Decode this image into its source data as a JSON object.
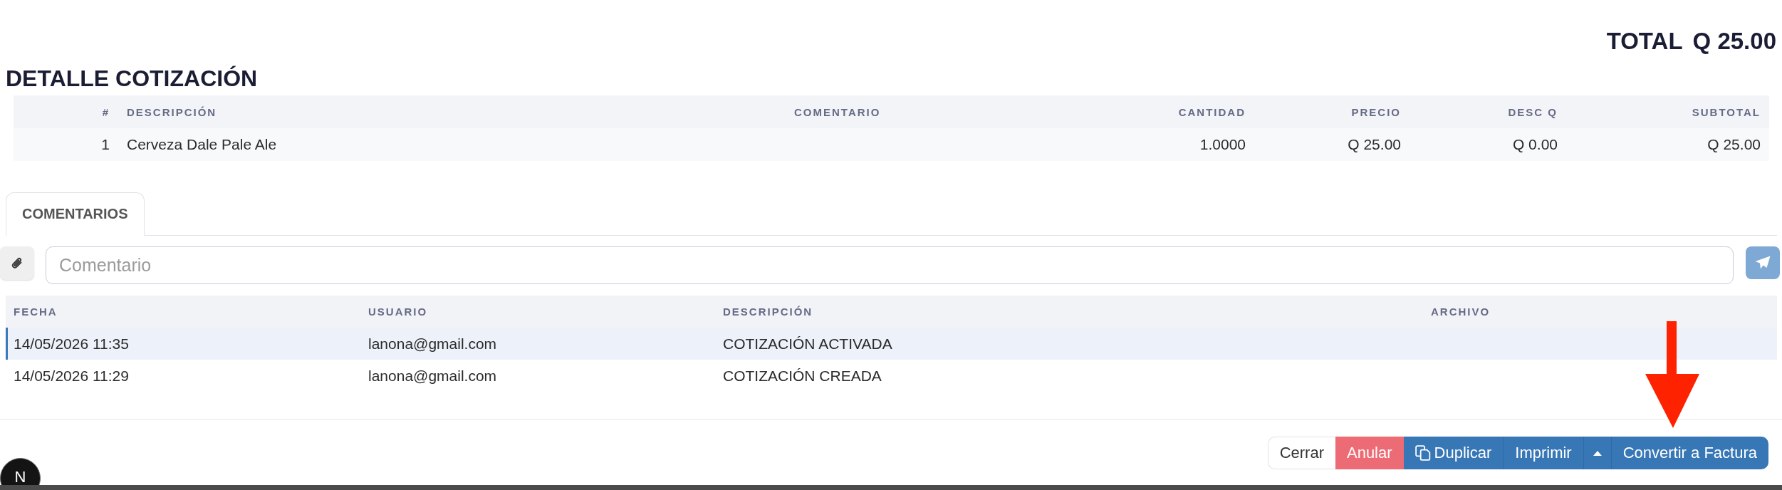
{
  "summary": {
    "total_label": "TOTAL",
    "total_value": "Q 25.00"
  },
  "detail": {
    "title": "DETALLE COTIZACIÓN",
    "columns": [
      "#",
      "DESCRIPCIÓN",
      "COMENTARIO",
      "CANTIDAD",
      "PRECIO",
      "DESC Q",
      "SUBTOTAL"
    ],
    "rows": [
      {
        "number": "1",
        "description": "Cerveza Dale Pale Ale",
        "quantity": "1.0000",
        "price": "Q 25.00",
        "discount": "Q 0.00",
        "subtotal": "Q 25.00"
      }
    ]
  },
  "comments": {
    "tabs": [
      {
        "label": "COMENTARIOS",
        "selected": true
      }
    ],
    "input": {
      "placeholder": "Comentario"
    },
    "columns": [
      "FECHA",
      "USUARIO",
      "DESCRIPCIÓN",
      "ARCHIVO"
    ],
    "rows": [
      {
        "date": "14/05/2026 11:35",
        "user": "lanona@gmail.com",
        "description": "COTIZACIÓN ACTIVADA",
        "selected": true
      },
      {
        "date": "14/05/2026 11:29",
        "user": "lanona@gmail.com",
        "description": "COTIZACIÓN CREADA",
        "selected": false
      }
    ]
  },
  "actions": [
    {
      "kind": "plain",
      "label": "Cerrar",
      "with_icon": false
    },
    {
      "kind": "danger",
      "label": "Anular",
      "with_icon": false
    },
    {
      "kind": "primary",
      "label": "Duplicar",
      "with_icon": true
    },
    {
      "kind": "primary",
      "label": "Imprimir",
      "with_icon": false
    },
    {
      "kind": "menu",
      "with_icon": false
    },
    {
      "kind": "primary",
      "label": "Convertir a Factura",
      "with_icon": false
    }
  ],
  "dev_indicator": {
    "label": "N"
  },
  "annotations": [
    {
      "kind": "arrow"
    }
  ]
}
